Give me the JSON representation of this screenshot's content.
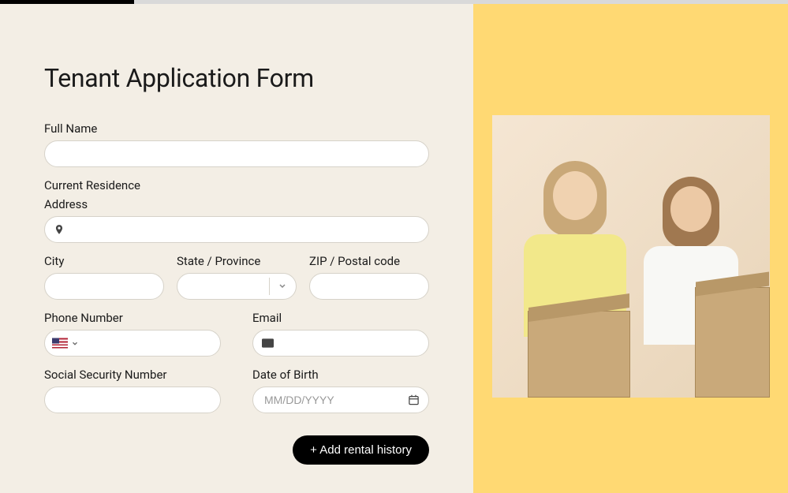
{
  "title": "Tenant Application Form",
  "labels": {
    "full_name": "Full Name",
    "current_residence": "Current Residence",
    "address": "Address",
    "city": "City",
    "state": "State / Province",
    "zip": "ZIP / Postal code",
    "phone": "Phone Number",
    "email": "Email",
    "ssn": "Social Security Number",
    "dob": "Date of Birth"
  },
  "values": {
    "full_name": "",
    "address": "",
    "city": "",
    "state": "",
    "zip": "",
    "phone": "",
    "email": "",
    "ssn": "",
    "dob": ""
  },
  "placeholders": {
    "dob": "MM/DD/YYYY"
  },
  "buttons": {
    "add_rental_history": "+ Add rental history"
  },
  "icons": {
    "location": "location-pin-icon",
    "email": "email-icon",
    "calendar": "calendar-icon",
    "chevron_down": "chevron-down-icon",
    "flag_us": "flag-us-icon"
  },
  "progress": {
    "percent": 17
  },
  "colors": {
    "sidebar_bg": "#ffd973",
    "page_bg": "#f3eee5",
    "button_bg": "#000000",
    "button_text": "#ffffff"
  }
}
